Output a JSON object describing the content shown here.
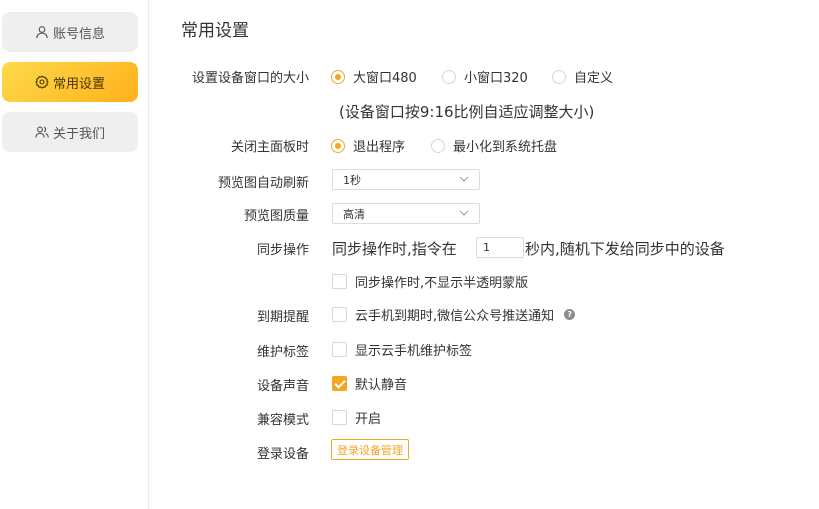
{
  "sidebar": {
    "items": [
      {
        "label": "账号信息",
        "icon": "user-icon",
        "active": false
      },
      {
        "label": "常用设置",
        "icon": "gear-icon",
        "active": true
      },
      {
        "label": "关于我们",
        "icon": "users-icon",
        "active": false
      }
    ]
  },
  "main": {
    "title": "常用设置",
    "window_size": {
      "label": "设置设备窗口的大小",
      "options": [
        "大窗口480",
        "小窗口320",
        "自定义"
      ],
      "selected": "大窗口480",
      "hint": "(设备窗口按9:16比例自适应调整大小)"
    },
    "close_panel": {
      "label": "关闭主面板时",
      "options": [
        "退出程序",
        "最小化到系统托盘"
      ],
      "selected": "退出程序"
    },
    "preview_refresh": {
      "label": "预览图自动刷新",
      "value": "1秒"
    },
    "preview_quality": {
      "label": "预览图质量",
      "value": "高清"
    },
    "sync": {
      "label": "同步操作",
      "text_before": "同步操作时,指令在",
      "value": "1",
      "text_after": "秒内,随机下发给同步中的设备",
      "checkbox_label": "同步操作时,不显示半透明蒙版",
      "checkbox_checked": false
    },
    "expiry": {
      "label": "到期提醒",
      "checkbox_label": "云手机到期时,微信公众号推送通知",
      "checked": false,
      "help": "?"
    },
    "maintenance": {
      "label": "维护标签",
      "checkbox_label": "显示云手机维护标签",
      "checked": false
    },
    "sound": {
      "label": "设备声音",
      "checkbox_label": "默认静音",
      "checked": true
    },
    "compat": {
      "label": "兼容模式",
      "checkbox_label": "开启",
      "checked": false
    },
    "login_devices": {
      "label": "登录设备",
      "button_label": "登录设备管理"
    }
  },
  "colors": {
    "accent": "#f5a623",
    "active_nav_start": "#ffd84a",
    "active_nav_end": "#ffb21c"
  }
}
